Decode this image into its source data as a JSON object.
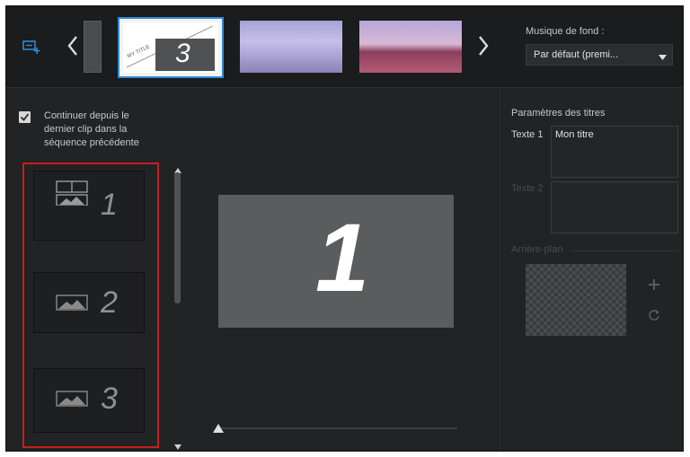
{
  "top": {
    "music_label": "Musique de fond :",
    "music_value": "Par défaut (premi...",
    "current_thumb_number": "3",
    "current_thumb_tag": "MY TITLE"
  },
  "left": {
    "continue_label_line1": "Continuer depuis le",
    "continue_label_line2": "dernier clip dans la",
    "continue_label_line3": "séquence précédente",
    "continue_checked": true,
    "slots": [
      "1",
      "2",
      "3"
    ],
    "preview_number": "1"
  },
  "right": {
    "title_params_label": "Paramètres des titres",
    "text1_label": "Texte 1",
    "text1_value": "Mon titre",
    "text2_label": "Texte 2",
    "background_label": "Arrière-plan"
  },
  "icons": {
    "add_slide": "add-slide-icon",
    "prev": "chevron-left-icon",
    "next": "chevron-right-icon",
    "dropdown": "caret-down-icon",
    "check": "checkbox-icon",
    "layout": "layout-icon",
    "picture": "picture-icon",
    "plus": "plus-icon",
    "rotate": "rotate-icon"
  },
  "colors": {
    "accent_blue": "#2e8ad8",
    "highlight_red": "#c61e1e",
    "panel_bg": "#222324"
  }
}
